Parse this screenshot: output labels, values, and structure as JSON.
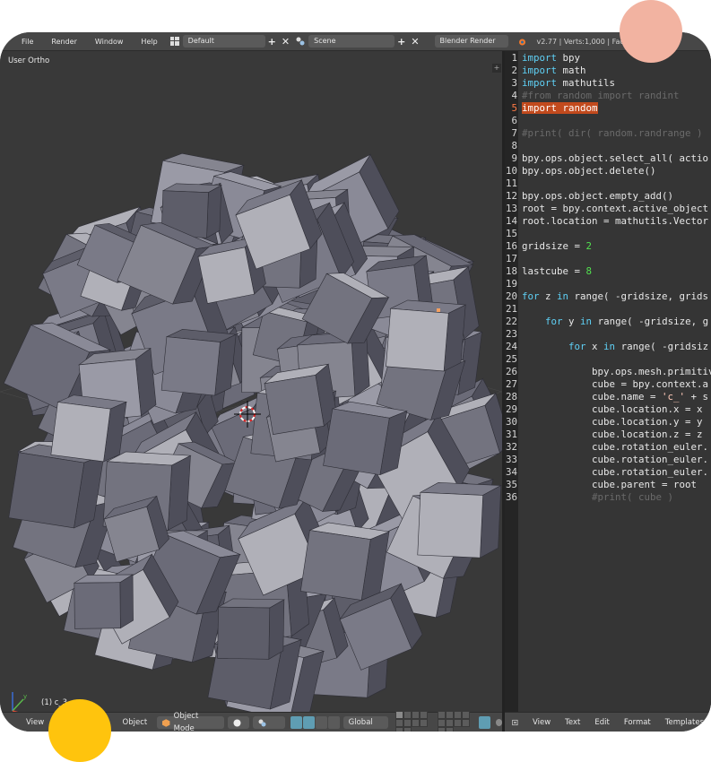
{
  "header": {
    "menus": [
      "File",
      "Render",
      "Window",
      "Help"
    ],
    "screen_layout": "Default",
    "scene": "Scene",
    "render_engine": "Blender Render",
    "stats": "v2.77 | Verts:1,000 | Faces:"
  },
  "viewport": {
    "view_label": "User Ortho",
    "object_label": "(1) c_3",
    "footer": {
      "view_menu": "View",
      "object_menu": "Object",
      "mode": "Object Mode",
      "orientation": "Global"
    }
  },
  "text_editor": {
    "current_line": 5,
    "lines": [
      {
        "n": "1",
        "t": [
          [
            "kw",
            "import"
          ],
          [
            "",
            "bpy"
          ]
        ]
      },
      {
        "n": "2",
        "t": [
          [
            "kw",
            "import"
          ],
          [
            "",
            "math"
          ]
        ]
      },
      {
        "n": "3",
        "t": [
          [
            "kw",
            "import"
          ],
          [
            "",
            "mathutils"
          ]
        ]
      },
      {
        "n": "4",
        "t": [
          [
            "cm",
            "#from random import randint"
          ]
        ]
      },
      {
        "n": "5",
        "t": [
          [
            "sel",
            "import random"
          ]
        ]
      },
      {
        "n": "6",
        "t": []
      },
      {
        "n": "7",
        "t": [
          [
            "cm",
            "#print( dir( random.randrange )"
          ]
        ]
      },
      {
        "n": "8",
        "t": []
      },
      {
        "n": "9",
        "t": [
          [
            "",
            "bpy.ops.object.select_all( actio"
          ]
        ]
      },
      {
        "n": "10",
        "t": [
          [
            "",
            "bpy.ops.object.delete()"
          ]
        ]
      },
      {
        "n": "11",
        "t": []
      },
      {
        "n": "12",
        "t": [
          [
            "",
            "bpy.ops.object.empty_add()"
          ]
        ]
      },
      {
        "n": "13",
        "t": [
          [
            "",
            "root = bpy.context.active_object"
          ]
        ]
      },
      {
        "n": "14",
        "t": [
          [
            "",
            "root.location = mathutils.Vector"
          ]
        ]
      },
      {
        "n": "15",
        "t": []
      },
      {
        "n": "16",
        "t": [
          [
            "",
            "gridsize = "
          ],
          [
            "num",
            "2"
          ]
        ]
      },
      {
        "n": "17",
        "t": []
      },
      {
        "n": "18",
        "t": [
          [
            "",
            "lastcube = "
          ],
          [
            "num",
            "8"
          ]
        ]
      },
      {
        "n": "19",
        "t": []
      },
      {
        "n": "20",
        "t": [
          [
            "kw",
            "for"
          ],
          [
            "",
            " z "
          ],
          [
            "kw",
            "in"
          ],
          [
            "",
            " range( -gridsize, grids"
          ]
        ]
      },
      {
        "n": "21",
        "t": []
      },
      {
        "n": "22",
        "t": [
          [
            "",
            "    "
          ],
          [
            "kw",
            "for"
          ],
          [
            "",
            " y "
          ],
          [
            "kw",
            "in"
          ],
          [
            "",
            " range( -gridsize, g"
          ]
        ]
      },
      {
        "n": "23",
        "t": []
      },
      {
        "n": "24",
        "t": [
          [
            "",
            "        "
          ],
          [
            "kw",
            "for"
          ],
          [
            "",
            " x "
          ],
          [
            "kw",
            "in"
          ],
          [
            "",
            " range( -gridsiz"
          ]
        ]
      },
      {
        "n": "25",
        "t": []
      },
      {
        "n": "26",
        "t": [
          [
            "",
            "            bpy.ops.mesh.primitiv"
          ]
        ]
      },
      {
        "n": "27",
        "t": [
          [
            "",
            "            cube = bpy.context.a"
          ]
        ]
      },
      {
        "n": "28",
        "t": [
          [
            "",
            "            cube.name = "
          ],
          [
            "str",
            "'c_'"
          ],
          [
            "",
            " + s"
          ]
        ]
      },
      {
        "n": "29",
        "t": [
          [
            "",
            "            cube.location.x = x"
          ]
        ]
      },
      {
        "n": "30",
        "t": [
          [
            "",
            "            cube.location.y = y"
          ]
        ]
      },
      {
        "n": "31",
        "t": [
          [
            "",
            "            cube.location.z = z"
          ]
        ]
      },
      {
        "n": "32",
        "t": [
          [
            "",
            "            cube.rotation_euler."
          ]
        ]
      },
      {
        "n": "33",
        "t": [
          [
            "",
            "            cube.rotation_euler."
          ]
        ]
      },
      {
        "n": "34",
        "t": [
          [
            "",
            "            cube.rotation_euler."
          ]
        ]
      },
      {
        "n": "35",
        "t": [
          [
            "",
            "            cube.parent = root"
          ]
        ]
      },
      {
        "n": "36",
        "t": [
          [
            "cm",
            "            #print( cube )"
          ]
        ]
      }
    ],
    "footer": {
      "menus": [
        "View",
        "Text",
        "Edit",
        "Format",
        "Templates"
      ]
    }
  },
  "colors": {
    "selection": "#c24a1d",
    "keyword": "#5fd0f5",
    "number": "#52e04f",
    "comment": "#6a6a6a",
    "active_tool": "#5f9db3"
  }
}
